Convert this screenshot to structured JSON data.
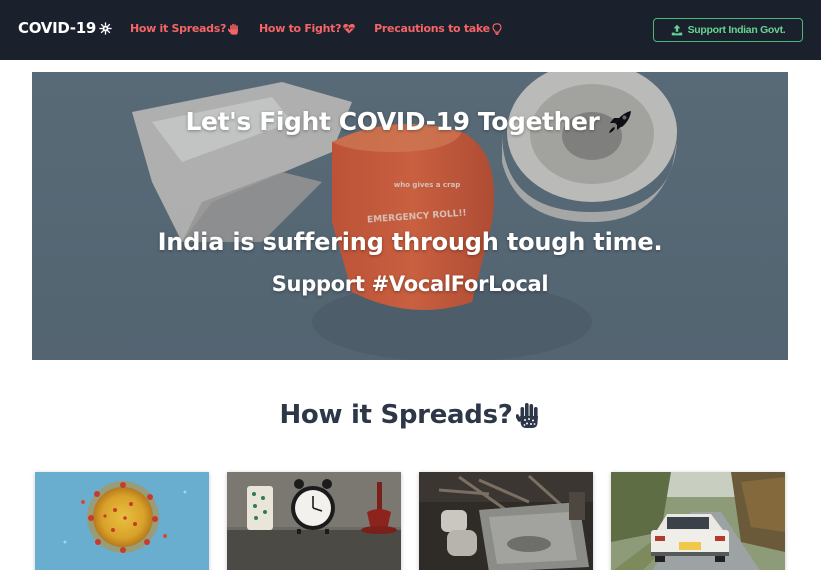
{
  "navbar": {
    "brand": "COVID-19",
    "brand_icon": "virus-icon",
    "links": [
      {
        "label": "How it Spreads?",
        "icon": "hand-icon"
      },
      {
        "label": "How to Fight?",
        "icon": "heartbeat-icon"
      },
      {
        "label": "Precautions to take",
        "icon": "lightbulb-icon"
      }
    ],
    "support_button": {
      "label": "Support Indian Govt.",
      "icon": "upload-icon"
    }
  },
  "hero": {
    "title": "Let's Fight COVID-19 Together",
    "title_icon": "rocket-icon",
    "line2": "India is suffering through tough time.",
    "line3": "Support #VocalForLocal",
    "image_text": [
      "who gives a crap",
      "EMERGENCY ROLL!!"
    ]
  },
  "section": {
    "title": "How it Spreads?",
    "title_icon": "hand-dots-icon"
  },
  "cards": [
    {
      "image": "coronavirus-microscope-image"
    },
    {
      "image": "alarm-clock-table-image"
    },
    {
      "image": "kitchen-sink-dishes-image"
    },
    {
      "image": "vintage-car-road-image"
    }
  ],
  "colors": {
    "navbar_bg": "#1a202c",
    "nav_link": "#f56565",
    "support_border": "#48bb78",
    "support_text": "#68d391",
    "heading": "#2d3748"
  }
}
